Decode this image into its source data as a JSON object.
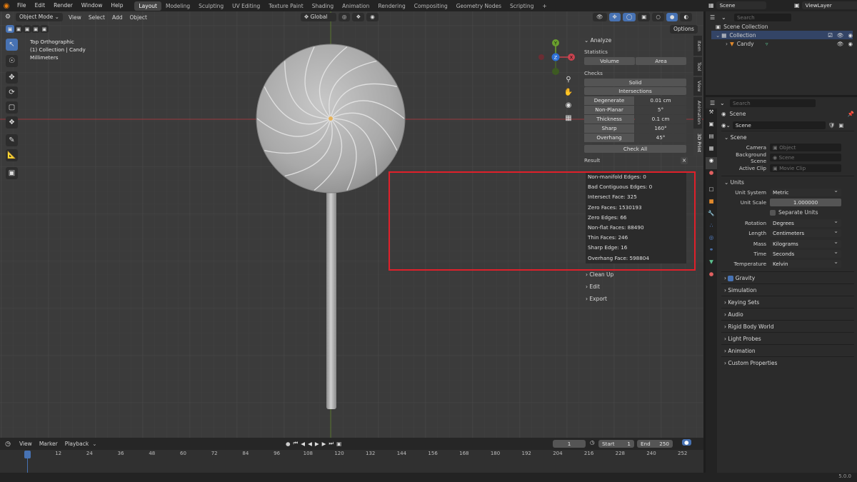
{
  "menubar": {
    "items": [
      "File",
      "Edit",
      "Render",
      "Window",
      "Help"
    ],
    "workspaces": [
      "Layout",
      "Modeling",
      "Sculpting",
      "UV Editing",
      "Texture Paint",
      "Shading",
      "Animation",
      "Rendering",
      "Compositing",
      "Geometry Nodes",
      "Scripting"
    ],
    "active_workspace": "Layout",
    "plus": "+",
    "scene": "Scene",
    "viewlayer": "ViewLayer"
  },
  "viewport_header": {
    "mode": "Object Mode",
    "menus": [
      "View",
      "Select",
      "Add",
      "Object"
    ],
    "orientation": "Global",
    "options": "Options"
  },
  "overlay": {
    "view_name": "Top Orthographic",
    "collection": "(1) Collection | Candy",
    "units": "Millimeters"
  },
  "gizmo": {
    "x": "X",
    "y": "Y",
    "z": "Z"
  },
  "npanel": {
    "analyze": "Analyze",
    "statistics": "Statistics",
    "volume": "Volume",
    "area": "Area",
    "checks": "Checks",
    "solid": "Solid",
    "intersections": "Intersections",
    "check_rows": [
      {
        "label": "Degenerate",
        "value": "0.01 cm"
      },
      {
        "label": "Non-Planar",
        "value": "5°"
      },
      {
        "label": "Thickness",
        "value": "0.1 cm"
      },
      {
        "label": "Sharp",
        "value": "160°"
      },
      {
        "label": "Overhang",
        "value": "45°"
      }
    ],
    "check_all": "Check All",
    "result": "Result",
    "close": "×",
    "results": [
      "Non-manifold Edges: 0",
      "Bad Contiguous Edges: 0",
      "Intersect Face: 325",
      "Zero Faces: 1530193",
      "Zero Edges: 66",
      "Non-flat Faces: 88490",
      "Thin Faces: 246",
      "Sharp Edge: 16",
      "Overhang Face: 598804"
    ],
    "clean_up": "Clean Up",
    "edit": "Edit",
    "export": "Export"
  },
  "vtabs": [
    "Item",
    "Tool",
    "View",
    "Animation",
    "3D Print"
  ],
  "timeline": {
    "menus": [
      "View",
      "Marker",
      "Playback"
    ],
    "current_frame": "1",
    "start_label": "Start",
    "start": "1",
    "end_label": "End",
    "end": "250",
    "ticks": [
      "1",
      "12",
      "24",
      "36",
      "48",
      "60",
      "72",
      "84",
      "96",
      "108",
      "120",
      "132",
      "144",
      "156",
      "168",
      "180",
      "192",
      "204",
      "216",
      "228",
      "240",
      "252"
    ]
  },
  "outliner": {
    "search_placeholder": "Search",
    "root": "Scene Collection",
    "collection": "Collection",
    "object": "Candy"
  },
  "properties": {
    "search_placeholder": "Search",
    "breadcrumb": "Scene",
    "scene_field": "Scene",
    "scene_section": "Scene",
    "camera_label": "Camera",
    "camera_placeholder": "Object",
    "bg_label": "Background Scene",
    "bg_placeholder": "Scene",
    "clip_label": "Active Clip",
    "clip_placeholder": "Movie Clip",
    "units_section": "Units",
    "unit_system_label": "Unit System",
    "unit_system": "Metric",
    "unit_scale_label": "Unit Scale",
    "unit_scale": "1.000000",
    "separate_units": "Separate Units",
    "rotation_label": "Rotation",
    "rotation": "Degrees",
    "length_label": "Length",
    "length": "Centimeters",
    "mass_label": "Mass",
    "mass": "Kilograms",
    "time_label": "Time",
    "time": "Seconds",
    "temperature_label": "Temperature",
    "temperature": "Kelvin",
    "sections": [
      "Gravity",
      "Simulation",
      "Keying Sets",
      "Audio",
      "Rigid Body World",
      "Light Probes",
      "Animation",
      "Custom Properties"
    ]
  },
  "status": {
    "version": "5.0.0"
  },
  "colors": {
    "accent": "#4772b3",
    "highlight_box": "#e0202a",
    "x_axis": "#c9434f",
    "y_axis": "#6aa02e",
    "z_axis": "#2d6fd6"
  }
}
